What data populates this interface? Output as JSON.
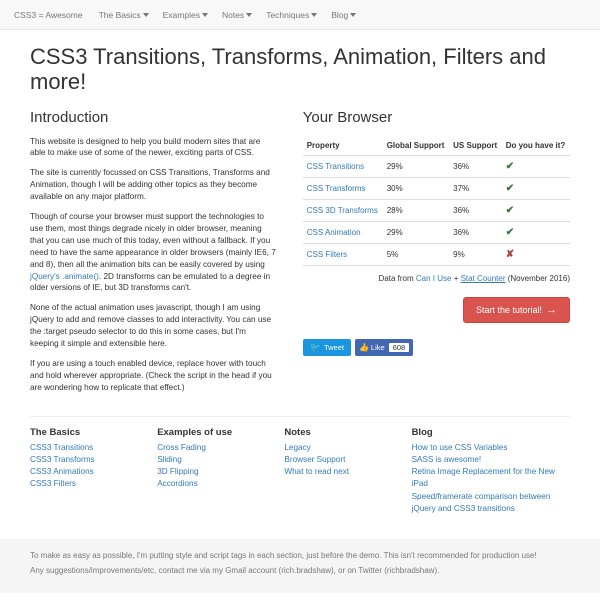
{
  "nav": {
    "brand": "CSS3 = Awesome",
    "items": [
      "The Basics",
      "Examples",
      "Notes",
      "Techniques",
      "Blog"
    ]
  },
  "title": "CSS3 Transitions, Transforms, Animation, Filters and more!",
  "intro": {
    "heading": "Introduction",
    "p1": "This website is designed to help you build modern sites that are able to make use of some of the newer, exciting parts of CSS.",
    "p2": "The site is currently focussed on CSS Transitions, Transforms and Animation, though I will be adding other topics as they become available on any major platform.",
    "p3a": "Though of course your browser must support the technologies to use them, most things degrade nicely in older browser, meaning that you can use much of this today, even without a fallback. If you need to have the same appearance in older browsers (mainly IE6, 7 and 8), then all the animation bits can be easily covered by using ",
    "p3_link": "jQuery's .animate()",
    "p3b": ". 2D transforms can be emulated to a degree in older versions of IE, but 3D transforms can't.",
    "p4": "None of the actual animation uses javascript, though I am using jQuery to add and remove classes to add interactivity. You can use the :target pseudo selector to do this in some cases, but I'm keeping it simple and extensible here.",
    "p5": "If you are using a touch enabled device, replace hover with touch and hold wherever appropriate. (Check the script in the head if you are wondering how to replicate that effect.)"
  },
  "browser": {
    "heading": "Your Browser",
    "headers": [
      "Property",
      "Global Support",
      "US Support",
      "Do you have it?"
    ],
    "rows": [
      {
        "name": "CSS Transitions",
        "global": "29%",
        "us": "36%",
        "have": true
      },
      {
        "name": "CSS Transforms",
        "global": "30%",
        "us": "37%",
        "have": true
      },
      {
        "name": "CSS 3D Transforms",
        "global": "28%",
        "us": "36%",
        "have": true
      },
      {
        "name": "CSS Animation",
        "global": "29%",
        "us": "36%",
        "have": true
      },
      {
        "name": "CSS Filters",
        "global": "5%",
        "us": "9%",
        "have": false
      }
    ],
    "data_from_prefix": "Data from ",
    "caniuse": "Can I Use",
    "plus": " + ",
    "statcounter": "Stat Counter",
    "date": " (November 2016)",
    "cta": "Start the tutorial!",
    "tweet": "Tweet",
    "like": "Like",
    "like_count": "608"
  },
  "footer": {
    "basics": {
      "heading": "The Basics",
      "items": [
        "CSS3 Transitions",
        "CSS3 Transforms",
        "CSS3 Animations",
        "CSS3 Filters"
      ]
    },
    "examples": {
      "heading": "Examples of use",
      "items": [
        "Cross Fading",
        "Sliding",
        "3D Flipping",
        "Accordions"
      ]
    },
    "notes": {
      "heading": "Notes",
      "items": [
        "Legacy",
        "Browser Support",
        "What to read next"
      ]
    },
    "blog": {
      "heading": "Blog",
      "items": [
        "How to use CSS Variables",
        "SASS is awesome!",
        "Retina Image Replacement for the New iPad",
        "Speed/framerate comparison between jQuery and CSS3 transitions"
      ]
    }
  },
  "bottom": {
    "p1": "To make as easy as possible, I'm putting style and script tags in each section, just before the demo. This isn't recommended for production use!",
    "p2": "Any suggestions/improvements/etc, contact me via my Gmail account (rich.bradshaw), or on Twitter (richbradshaw)."
  }
}
